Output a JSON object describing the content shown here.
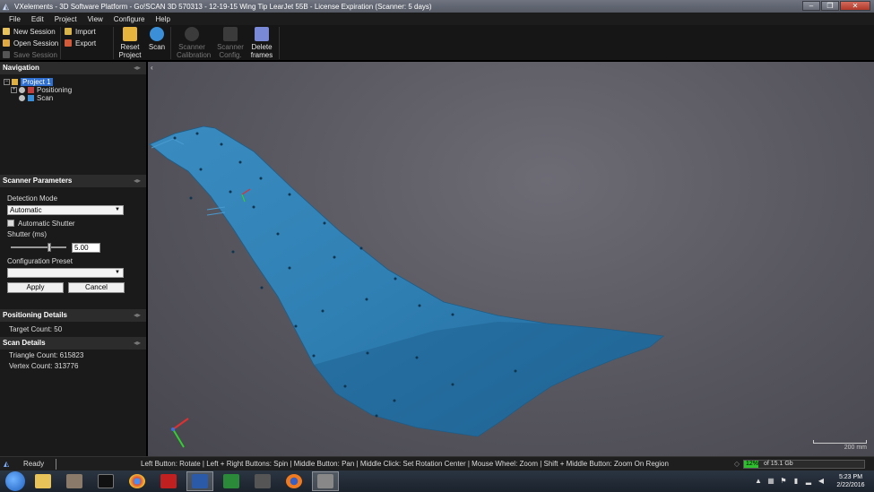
{
  "window": {
    "title": "VXelements - 3D Software Platform - Go!SCAN 3D 570313 - 12-19-15 Wing Tip LearJet 55B - License Expiration (Scanner: 5 days)"
  },
  "menu": [
    "File",
    "Edit",
    "Project",
    "View",
    "Configure",
    "Help"
  ],
  "toolbar": {
    "new_session": "New Session",
    "open_session": "Open Session",
    "save_session": "Save Session",
    "import": "Import",
    "export": "Export",
    "reset_project_1": "Reset",
    "reset_project_2": "Project",
    "scan": "Scan",
    "scanner_calibration_1": "Scanner",
    "scanner_calibration_2": "Calibration",
    "scanner_config_1": "Scanner",
    "scanner_config_2": "Config.",
    "delete_frames_1": "Delete",
    "delete_frames_2": "frames"
  },
  "navigation": {
    "header": "Navigation",
    "project": "Project 1",
    "positioning": "Positioning",
    "scan": "Scan"
  },
  "scanner_parameters": {
    "header": "Scanner Parameters",
    "detection_mode_label": "Detection Mode",
    "detection_mode_value": "Automatic",
    "automatic_shutter": "Automatic Shutter",
    "shutter_label": "Shutter (ms)",
    "shutter_value": "5.00",
    "shutter_level": 0.72,
    "configuration_preset_label": "Configuration Preset",
    "configuration_preset_value": "",
    "apply": "Apply",
    "cancel": "Cancel"
  },
  "positioning_details": {
    "header": "Positioning Details",
    "target_count": "Target Count: 50"
  },
  "scan_details": {
    "header": "Scan Details",
    "triangle_count": "Triangle Count: 615823",
    "vertex_count": "Vertex Count: 313776"
  },
  "viewport": {
    "scale_label": "200 mm",
    "model_color": "#2e7fb2",
    "background_color": "#5e5d65"
  },
  "status": {
    "ready": "Ready",
    "hints": "Left Button: Rotate  |  Left + Right Buttons: Spin  |  Middle Button: Pan  |  Middle Click: Set Rotation Center  |  Mouse Wheel: Zoom  |  Shift + Middle Button: Zoom On Region",
    "memory_percent": "12%",
    "memory_fraction": 0.12,
    "memory_total": "of 15.1 Gb"
  },
  "taskbar": {
    "time": "5:23 PM",
    "date": "2/22/2016"
  }
}
